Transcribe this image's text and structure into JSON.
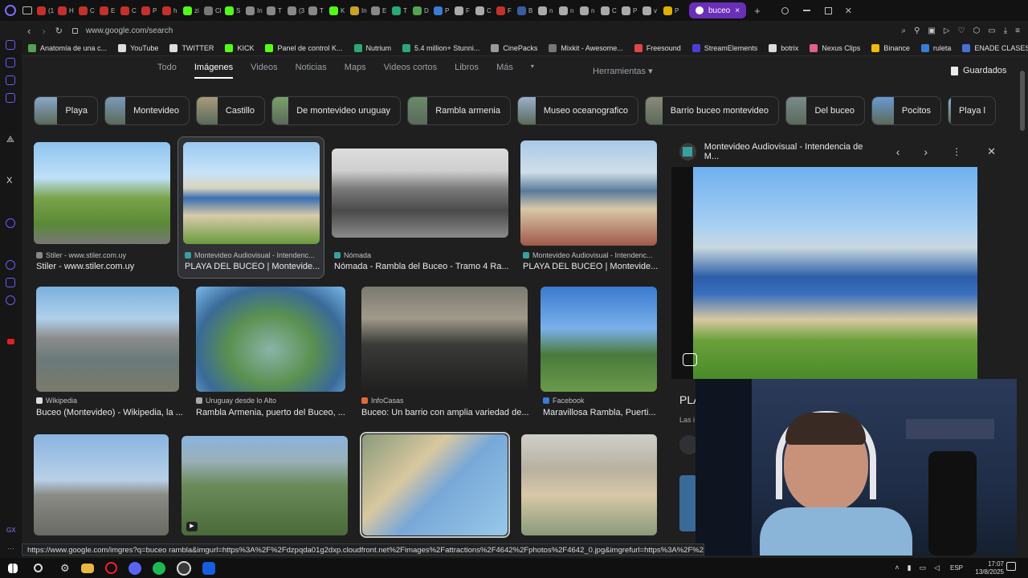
{
  "tabs": {
    "items": [
      {
        "label": "(1",
        "color": "#c4302b"
      },
      {
        "label": "H",
        "color": "#c4302b"
      },
      {
        "label": "C",
        "color": "#c4302b"
      },
      {
        "label": "E",
        "color": "#c4302b"
      },
      {
        "label": "C",
        "color": "#c4302b"
      },
      {
        "label": "P",
        "color": "#c4302b"
      },
      {
        "label": "h",
        "color": "#c4302b"
      },
      {
        "label": "zi",
        "color": "#53fc18"
      },
      {
        "label": "Cl",
        "color": "#777"
      },
      {
        "label": "S",
        "color": "#53fc18"
      },
      {
        "label": "In",
        "color": "#888"
      },
      {
        "label": "T",
        "color": "#888"
      },
      {
        "label": "(3",
        "color": "#888"
      },
      {
        "label": "T",
        "color": "#888"
      },
      {
        "label": "K",
        "color": "#53fc18"
      },
      {
        "label": "In",
        "color": "#c9a227"
      },
      {
        "label": "E",
        "color": "#888"
      },
      {
        "label": "T",
        "color": "#2aa876"
      },
      {
        "label": "D",
        "color": "#53a34f"
      },
      {
        "label": "P",
        "color": "#3a7bd5"
      },
      {
        "label": "F",
        "color": "#aaa"
      },
      {
        "label": "C",
        "color": "#aaa"
      },
      {
        "label": "F",
        "color": "#c4302b"
      },
      {
        "label": "B",
        "color": "#3a5ba0"
      },
      {
        "label": "n",
        "color": "#aaa"
      },
      {
        "label": "n",
        "color": "#aaa"
      },
      {
        "label": "n",
        "color": "#aaa"
      },
      {
        "label": "C",
        "color": "#aaa"
      },
      {
        "label": "P",
        "color": "#aaa"
      },
      {
        "label": "v",
        "color": "#aaa"
      },
      {
        "label": "P",
        "color": "#e0b000"
      }
    ],
    "active_label": "buceo"
  },
  "address": {
    "url": "www.google.com/search"
  },
  "bookmarks": [
    {
      "label": "Anatomía de una c...",
      "color": "#53a34f"
    },
    {
      "label": "YouTube",
      "color": "#ddd"
    },
    {
      "label": "TWITTER",
      "color": "#ddd"
    },
    {
      "label": "KICK",
      "color": "#53fc18"
    },
    {
      "label": "Panel de control K...",
      "color": "#53fc18"
    },
    {
      "label": "Nutrium",
      "color": "#2aa876"
    },
    {
      "label": "5.4 million+ Stunni...",
      "color": "#2aa876"
    },
    {
      "label": "CinePacks",
      "color": "#999"
    },
    {
      "label": "Mixkit - Awesome...",
      "color": "#777"
    },
    {
      "label": "Freesound",
      "color": "#e04646"
    },
    {
      "label": "StreamElements",
      "color": "#4b3fd8"
    },
    {
      "label": "botrix",
      "color": "#ddd"
    },
    {
      "label": "Nexus Clips",
      "color": "#e06090"
    },
    {
      "label": "Binance",
      "color": "#f0b90b"
    },
    {
      "label": "ruleta",
      "color": "#3a7bd5"
    },
    {
      "label": "ENADE CLASES T...",
      "color": "#4a6fd8"
    }
  ],
  "search_tabs": [
    "Todo",
    "Imágenes",
    "Videos",
    "Noticias",
    "Maps",
    "Videos cortos",
    "Libros",
    "Más"
  ],
  "tools_label": "Herramientas",
  "saved_label": "Guardados",
  "chips": [
    {
      "label": "Playa",
      "w": 80
    },
    {
      "label": "Montevideo",
      "w": 106
    },
    {
      "label": "Castillo",
      "w": 86
    },
    {
      "label": "De montevideo uruguay",
      "w": 161
    },
    {
      "label": "Rambla armenia",
      "w": 129
    },
    {
      "label": "Museo oceanografico",
      "w": 151
    },
    {
      "label": "Barrio buceo montevideo",
      "w": 167
    },
    {
      "label": "Del buceo",
      "w": 99
    },
    {
      "label": "Pocitos",
      "w": 87
    },
    {
      "label": "Playa l",
      "w": 60
    }
  ],
  "results": [
    {
      "source": "Stiler - www.stiler.com.uy",
      "title": "Stiler - www.stiler.com.uy",
      "src_color": "#888"
    },
    {
      "source": "Montevideo Audiovisual - Intendenc...",
      "title": "PLAYA DEL BUCEO | Montevide...",
      "src_color": "#39a0a0"
    },
    {
      "source": "Nómada",
      "title": "Nómada - Rambla del Buceo - Tramo 4 Ra...",
      "src_color": "#39a0a0"
    },
    {
      "source": "Montevideo Audiovisual - Intendenc...",
      "title": "PLAYA DEL BUCEO | Montevide...",
      "src_color": "#39a0a0"
    },
    {
      "source": "Wikipedia",
      "title": "Buceo (Montevideo) - Wikipedia, la ...",
      "src_color": "#ddd"
    },
    {
      "source": "Uruguay desde lo Alto",
      "title": "Rambla Armenia, puerto del Buceo, ...",
      "src_color": "#aaa"
    },
    {
      "source": "InfoCasas",
      "title": "Buceo: Un barrio con amplia variedad de...",
      "src_color": "#e06a3a"
    },
    {
      "source": "Facebook",
      "title": "Maravillosa Rambla, Puerti...",
      "src_color": "#3a7bd5"
    }
  ],
  "preview": {
    "title": "Montevideo Audiovisual - Intendencia de M...",
    "caption": "PLA",
    "subcaption": "Las i"
  },
  "status_url": "https://www.google.com/imgres?q=buceo rambla&imgurl=https%3A%2F%2Fdzpqda01g2dxp.cloudfront.net%2Fimages%2Fattractions%2F4642%2Fphotos%2F4642_0.jpg&imgrefurl=https%3A%2F%2F...",
  "system": {
    "lang": "ESP",
    "time": "17:07",
    "date": "13/8/2025"
  },
  "colors": {
    "accent": "#6a2fb8",
    "bg": "#1f1f1f"
  }
}
